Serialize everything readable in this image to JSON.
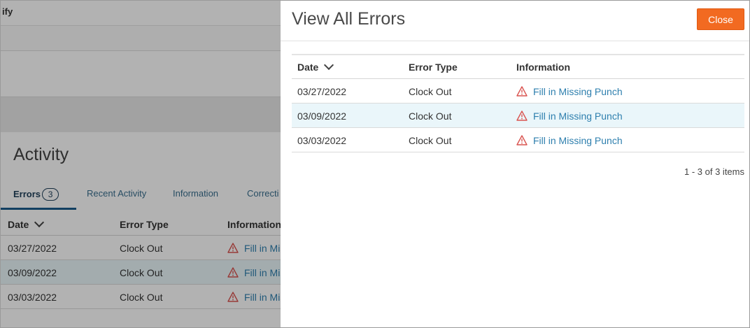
{
  "background": {
    "app_title": "ify",
    "heading": "Activity",
    "tabs": [
      {
        "label": "Errors",
        "badge": "3"
      },
      {
        "label": "Recent Activity"
      },
      {
        "label": "Information"
      },
      {
        "label": "Correcti"
      }
    ],
    "columns": [
      "Date",
      "Error Type",
      "Information"
    ],
    "rows": [
      {
        "date": "03/27/2022",
        "type": "Clock Out",
        "info": "Fill in Mis"
      },
      {
        "date": "03/09/2022",
        "type": "Clock Out",
        "info": "Fill in Mis"
      },
      {
        "date": "03/03/2022",
        "type": "Clock Out",
        "info": "Fill in Mis"
      }
    ]
  },
  "modal": {
    "title": "View All Errors",
    "close_label": "Close",
    "columns": {
      "date": "Date",
      "error_type": "Error Type",
      "information": "Information"
    },
    "rows": [
      {
        "date": "03/27/2022",
        "type": "Clock Out",
        "info": "Fill in Missing Punch"
      },
      {
        "date": "03/09/2022",
        "type": "Clock Out",
        "info": "Fill in Missing Punch"
      },
      {
        "date": "03/03/2022",
        "type": "Clock Out",
        "info": "Fill in Missing Punch"
      }
    ],
    "pager": "1 - 3 of 3 items"
  },
  "icons": {
    "sort": "chevron-down-icon",
    "row_info": "warning-triangle-icon"
  },
  "colors": {
    "accent": "#f26a21",
    "link": "#2e7fae",
    "warning": "#d9534f",
    "highlight_row": "#eaf6fa"
  }
}
